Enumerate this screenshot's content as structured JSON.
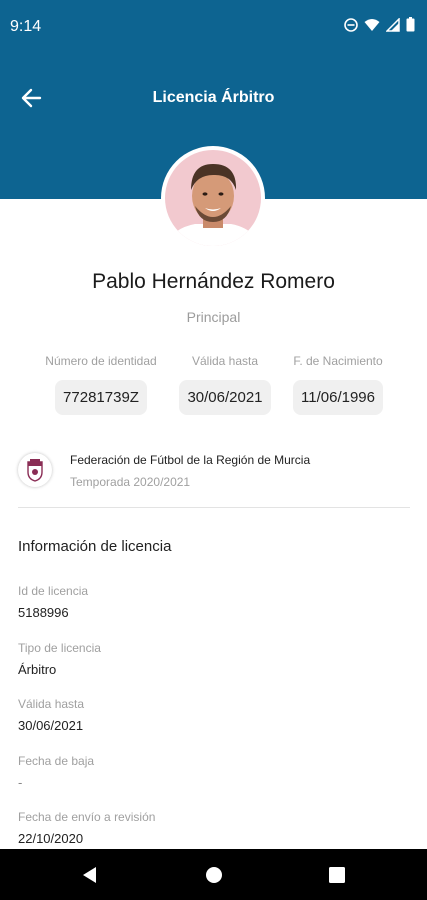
{
  "status_bar": {
    "time": "9:14",
    "icons": [
      "do-not-disturb-icon",
      "wifi-icon",
      "signal-icon",
      "battery-icon"
    ]
  },
  "header": {
    "title": "Licencia Árbitro",
    "back_icon": "arrow-left-icon",
    "color": "#0d6491"
  },
  "profile": {
    "name": "Pablo Hernández Romero",
    "role": "Principal"
  },
  "identity": [
    {
      "label": "Número de identidad",
      "value": "77281739Z"
    },
    {
      "label": "Válida hasta",
      "value": "30/06/2021"
    },
    {
      "label": "F. de Nacimiento",
      "value": "11/06/1996"
    }
  ],
  "federation": {
    "name": "Federación de Fútbol de la Región de Murcia",
    "season": "Temporada 2020/2021"
  },
  "license_info": {
    "title": "Información de licencia",
    "fields": [
      {
        "label": "Id de licencia",
        "value": "5188996"
      },
      {
        "label": "Tipo de licencia",
        "value": "Árbitro"
      },
      {
        "label": "Válida hasta",
        "value": "30/06/2021"
      },
      {
        "label": "Fecha de baja",
        "value": "-"
      },
      {
        "label": "Fecha de envío a revisión",
        "value": "22/10/2020"
      }
    ]
  },
  "nav_bar": {
    "icons": [
      "back-triangle-icon",
      "home-circle-icon",
      "recents-square-icon"
    ]
  }
}
